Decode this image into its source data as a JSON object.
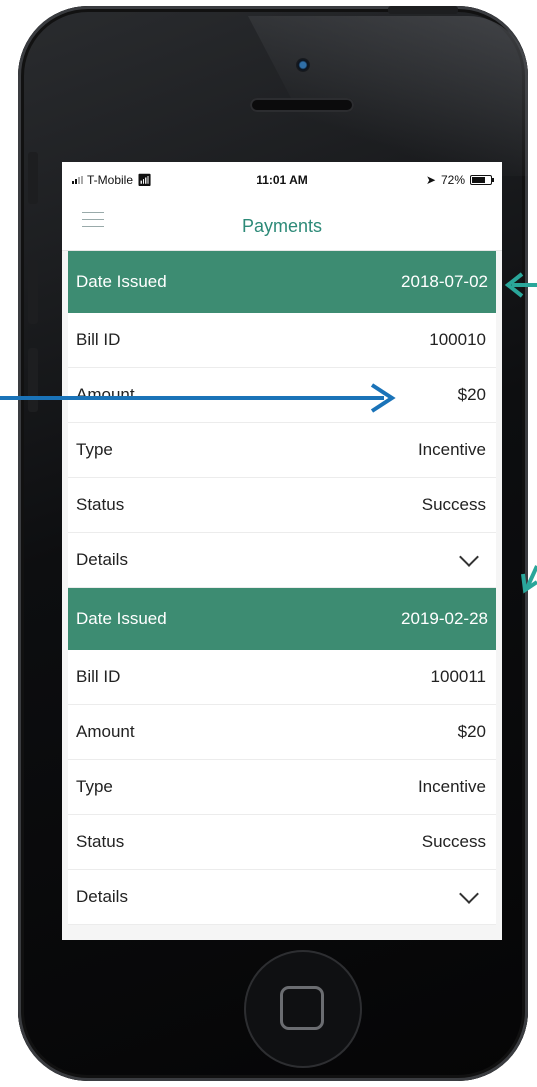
{
  "status_bar": {
    "carrier": "T-Mobile",
    "time": "11:01 AM",
    "battery": "72%",
    "battery_level": 0.72,
    "icons": [
      "signal-icon",
      "wifi-icon",
      "location-arrow-icon",
      "battery-icon"
    ]
  },
  "navbar": {
    "title": "Payments",
    "menu_icon": "hamburger-menu-icon"
  },
  "payments": [
    {
      "header": {
        "label": "Date Issued",
        "value": "2018-07-02"
      },
      "rows": [
        {
          "label": "Bill ID",
          "value": "100010"
        },
        {
          "label": "Amount",
          "value": "$20"
        },
        {
          "label": "Type",
          "value": "Incentive"
        },
        {
          "label": "Status",
          "value": "Success"
        },
        {
          "label": "Details",
          "value": ""
        }
      ]
    },
    {
      "header": {
        "label": "Date Issued",
        "value": "2019-02-28"
      },
      "rows": [
        {
          "label": "Bill ID",
          "value": "100011"
        },
        {
          "label": "Amount",
          "value": "$20"
        },
        {
          "label": "Type",
          "value": "Incentive"
        },
        {
          "label": "Status",
          "value": "Success"
        },
        {
          "label": "Details",
          "value": ""
        }
      ]
    }
  ],
  "colors": {
    "header_bg": "#3d8c72",
    "title": "#2d8a78",
    "annotation_blue": "#1a73b8",
    "annotation_teal": "#2aa69a"
  }
}
